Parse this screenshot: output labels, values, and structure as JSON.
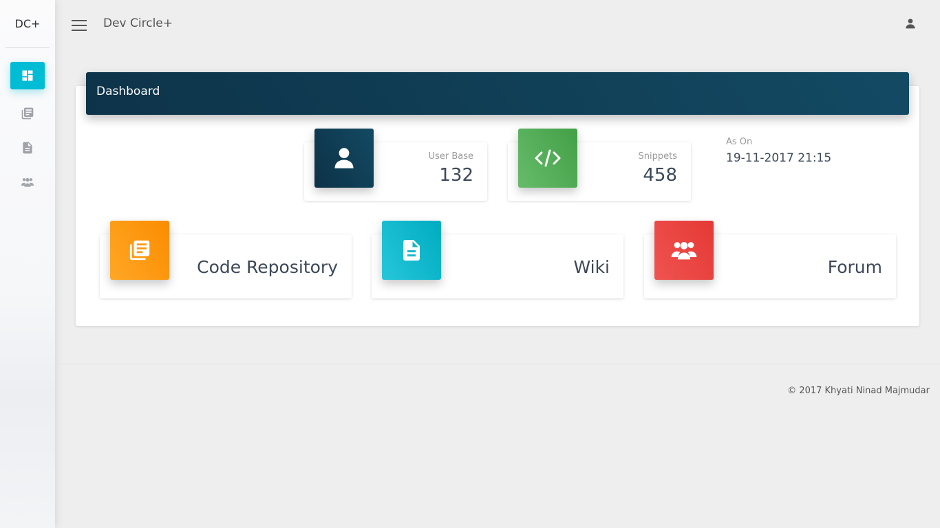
{
  "sidebar": {
    "logo": "DC+",
    "items": [
      {
        "icon": "dashboard-icon",
        "active": true
      },
      {
        "icon": "library-books-icon",
        "active": false
      },
      {
        "icon": "description-icon",
        "active": false
      },
      {
        "icon": "group-icon",
        "active": false
      }
    ]
  },
  "topbar": {
    "brand": "Dev Circle+",
    "menu_icon": "menu-icon",
    "user_icon": "person-icon"
  },
  "dashboard": {
    "title": "Dashboard",
    "stats": [
      {
        "label": "User Base",
        "value": "132",
        "icon": "person-icon",
        "color": "#0f3e56"
      },
      {
        "label": "Snippets",
        "value": "458",
        "icon": "code-icon",
        "color": "#4caf50"
      }
    ],
    "as_on_label": "As On",
    "as_on_value": "19-11-2017 21:15",
    "modules": [
      {
        "label": "Code Repository",
        "icon": "library-books-icon",
        "color": "#ff9800"
      },
      {
        "label": "Wiki",
        "icon": "description-icon",
        "color": "#00bcd4"
      },
      {
        "label": "Forum",
        "icon": "group-icon",
        "color": "#f44336"
      }
    ]
  },
  "footer": {
    "copyright": "© 2017 Khyati Ninad Majmudar"
  },
  "colors": {
    "accent": "#00bcd4",
    "header_bg": "#0f3e56"
  }
}
